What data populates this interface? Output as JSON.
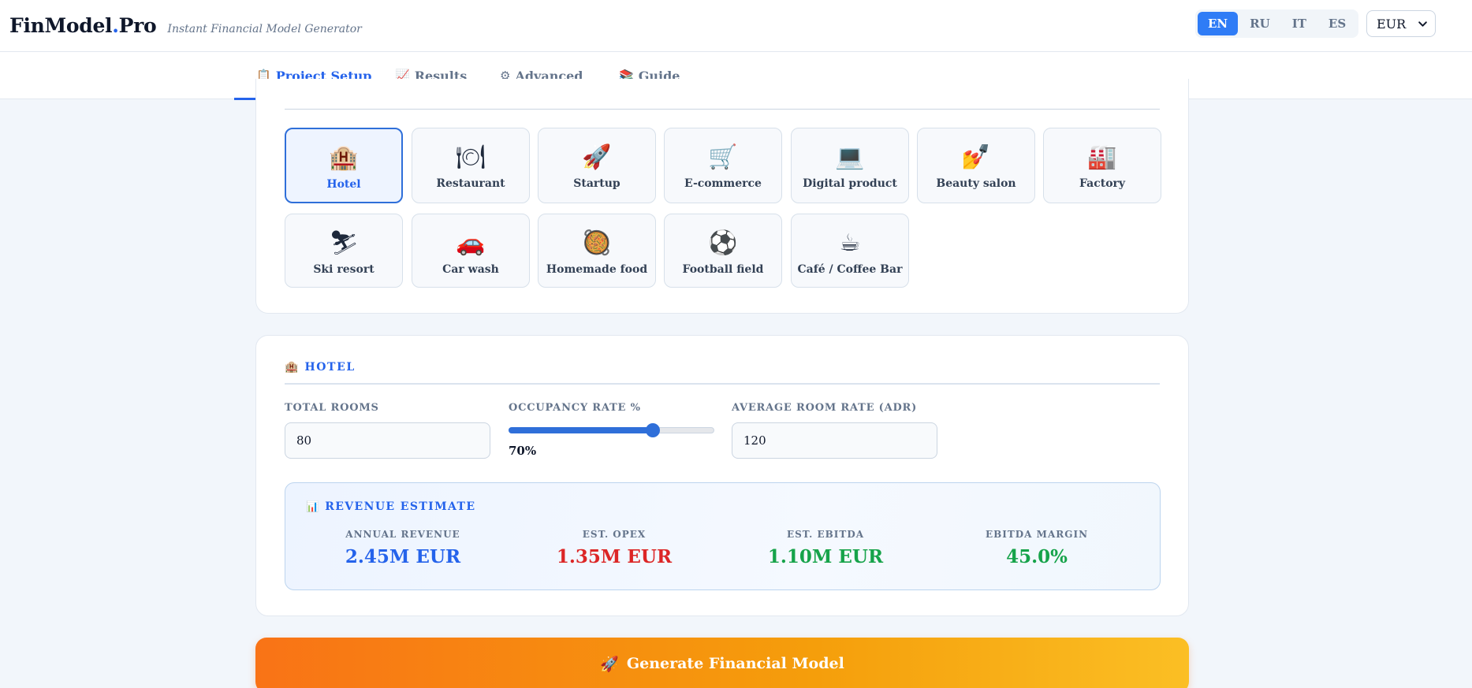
{
  "header": {
    "brand_main": "FinModel",
    "brand_dot": ".",
    "brand_suffix": "Pro",
    "tagline": "Instant Financial Model Generator",
    "languages": [
      "EN",
      "RU",
      "IT",
      "ES"
    ],
    "active_language": "EN",
    "currency": "EUR"
  },
  "tabs": [
    {
      "label": "Project Setup",
      "icon": "📋",
      "icon_name": "clipboard-icon",
      "active": true
    },
    {
      "label": "Results",
      "icon": "📈",
      "icon_name": "chart-up-icon",
      "active": false
    },
    {
      "label": "Advanced",
      "icon": "⚙",
      "icon_name": "gear-icon",
      "active": false
    },
    {
      "label": "Guide",
      "icon": "📚",
      "icon_name": "books-icon",
      "active": false
    }
  ],
  "business_types": [
    {
      "label": "Hotel",
      "icon": "🏨",
      "icon_name": "hotel-icon",
      "active": true
    },
    {
      "label": "Restaurant",
      "icon": "🍽",
      "icon_name": "plate-cutlery-icon",
      "active": false
    },
    {
      "label": "Startup",
      "icon": "🚀",
      "icon_name": "rocket-icon",
      "active": false
    },
    {
      "label": "E-commerce",
      "icon": "🛒",
      "icon_name": "shopping-cart-icon",
      "active": false
    },
    {
      "label": "Digital product",
      "icon": "💻",
      "icon_name": "laptop-icon",
      "active": false
    },
    {
      "label": "Beauty salon",
      "icon": "💅",
      "icon_name": "nail-polish-icon",
      "active": false
    },
    {
      "label": "Factory",
      "icon": "🏭",
      "icon_name": "factory-icon",
      "active": false
    },
    {
      "label": "Ski resort",
      "icon": "⛷",
      "icon_name": "skier-icon",
      "active": false
    },
    {
      "label": "Car wash",
      "icon": "🚗",
      "icon_name": "car-icon",
      "active": false
    },
    {
      "label": "Homemade food",
      "icon": "🥘",
      "icon_name": "pan-food-icon",
      "active": false
    },
    {
      "label": "Football field",
      "icon": "⚽",
      "icon_name": "soccer-ball-icon",
      "active": false
    },
    {
      "label": "Café / Coffee Bar",
      "icon": "☕",
      "icon_name": "coffee-cup-icon",
      "active": false
    }
  ],
  "hotel": {
    "section_title": "HOTEL",
    "section_icon": "🏨",
    "fields": {
      "rooms_label": "TOTAL ROOMS",
      "rooms_value": "80",
      "occupancy_label": "OCCUPANCY RATE %",
      "occupancy_percent": 70,
      "occupancy_display": "70%",
      "adr_label": "AVERAGE ROOM RATE (ADR)",
      "adr_value": "120"
    },
    "estimate": {
      "title": "REVENUE ESTIMATE",
      "icon": "📊",
      "metrics": [
        {
          "label": "ANNUAL REVENUE",
          "value": "2.45M EUR",
          "color": "#2563eb"
        },
        {
          "label": "EST. OPEX",
          "value": "1.35M EUR",
          "color": "#dc2626"
        },
        {
          "label": "EST. EBITDA",
          "value": "1.10M EUR",
          "color": "#16a34a"
        },
        {
          "label": "EBITDA MARGIN",
          "value": "45.0%",
          "color": "#16a34a"
        }
      ]
    }
  },
  "generate": {
    "label": "Generate Financial Model",
    "icon": "🚀"
  },
  "colors": {
    "accent": "#2563eb",
    "generate_start": "#f97316",
    "generate_end": "#fbbf24"
  }
}
